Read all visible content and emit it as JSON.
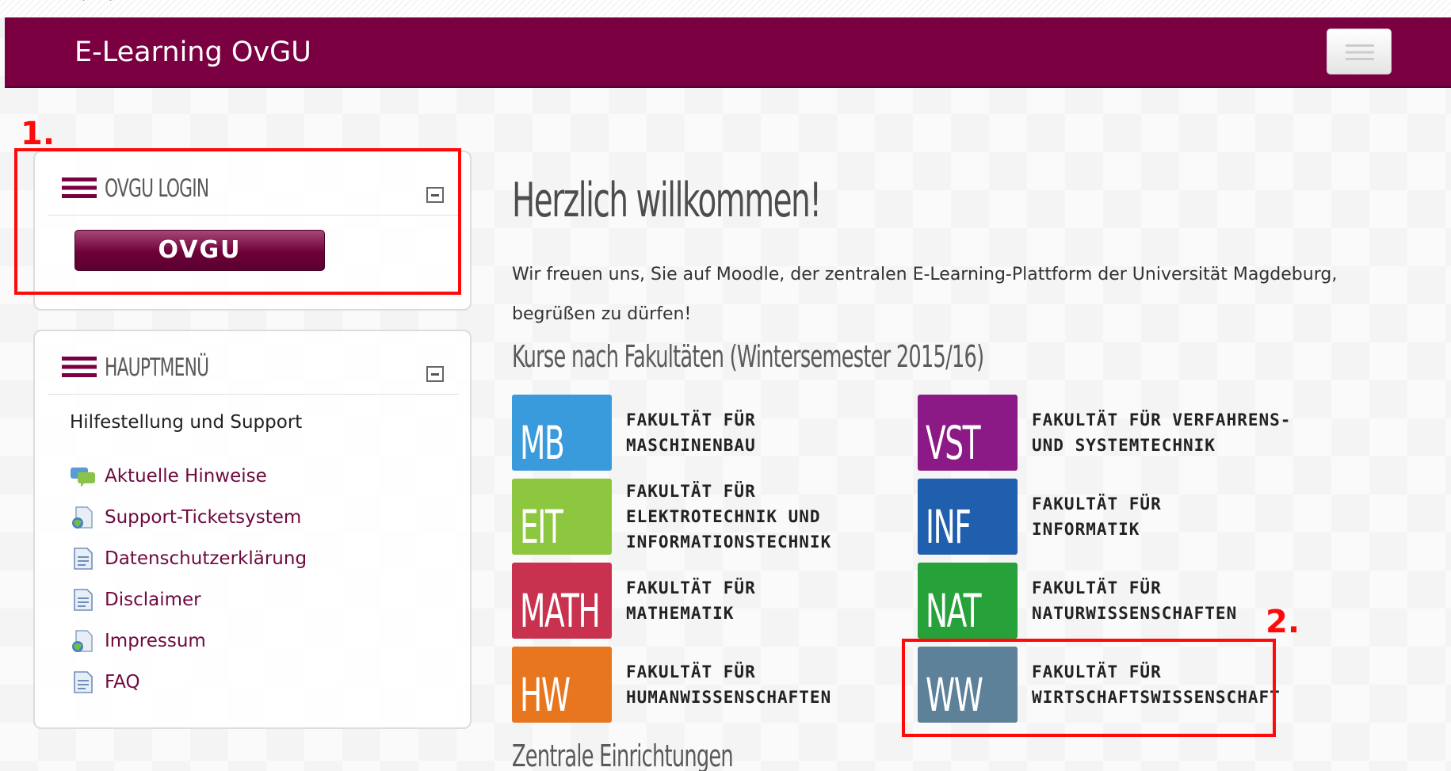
{
  "topbar": {
    "chevrons": "˅ ˅"
  },
  "navbar": {
    "brand": "E-Learning OvGU"
  },
  "blocks": {
    "login": {
      "title": "OVGU LOGIN",
      "button_label": "OVGU"
    },
    "main_menu": {
      "title": "HAUPTMENÜ",
      "heading": "Hilfestellung und Support",
      "items": [
        {
          "label": "Aktuelle Hinweise",
          "icon": "forum-icon"
        },
        {
          "label": "Support-Ticketsystem",
          "icon": "url-icon"
        },
        {
          "label": "Datenschutzerklärung",
          "icon": "page-icon"
        },
        {
          "label": "Disclaimer",
          "icon": "page-icon"
        },
        {
          "label": "Impressum",
          "icon": "url-icon"
        },
        {
          "label": "FAQ",
          "icon": "page-icon"
        }
      ]
    }
  },
  "main": {
    "welcome": "Herzlich willkommen!",
    "intro": "Wir freuen uns, Sie auf Moodle, der zentralen E-Learning-Plattform der Universität Magdeburg, begrüßen zu dürfen!",
    "faculties_heading": "Kurse nach Fakultäten (Wintersemester 2015/16)",
    "faculties": [
      {
        "code": "MB",
        "name": "FAKULTÄT FÜR\nMASCHINENBAU",
        "color": "#3a9bdc"
      },
      {
        "code": "VST",
        "name": "FAKULTÄT FÜR VERFAHRENS-\nUND SYSTEMTECHNIK",
        "color": "#8b1a86"
      },
      {
        "code": "EIT",
        "name": "FAKULTÄT FÜR\nELEKTROTECHNIK UND\nINFORMATIONSTECHNIK",
        "color": "#8dc63f"
      },
      {
        "code": "INF",
        "name": "FAKULTÄT FÜR\nINFORMATIK",
        "color": "#1f5fad"
      },
      {
        "code": "MATH",
        "name": "FAKULTÄT FÜR\nMATHEMATIK",
        "color": "#c8324e"
      },
      {
        "code": "NAT",
        "name": "FAKULTÄT FÜR\nNATURWISSENSCHAFTEN",
        "color": "#27a23a"
      },
      {
        "code": "HW",
        "name": "FAKULTÄT FÜR\nHUMANWISSENSCHAFTEN",
        "color": "#e8761f"
      },
      {
        "code": "WW",
        "name": "FAKULTÄT FÜR\nWIRTSCHAFTSWISSENSCHAFT",
        "color": "#5c8199"
      }
    ],
    "central_heading": "Zentrale Einrichtungen"
  },
  "annotations": {
    "first": "1.",
    "second": "2.",
    "color": "#ff0a0a"
  },
  "colors": {
    "brand": "#7a0041"
  }
}
